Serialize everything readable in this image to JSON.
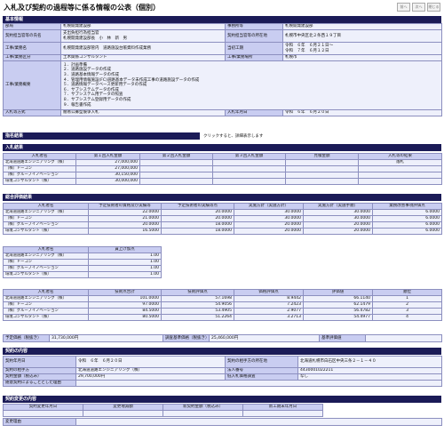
{
  "page": {
    "title": "入札及び契約の過程等に係る情報の公表（個別）",
    "nav_prev": "前へ",
    "nav_next": "次へ",
    "nav_close": "閉じる"
  },
  "basic": {
    "header": "基本情報",
    "rows": [
      {
        "l1": "部局",
        "v1": "札幌開発建設部",
        "l2": "事務所等",
        "v2": "札幌開発建設部"
      },
      {
        "l1": "契約担当官等の氏名",
        "v1": "支出負担行為担当官\n札幌開発建設部長　小　林　新　男",
        "l2": "契約担当官等の所在地",
        "v2": "札幌市中央区北２条西１９丁目"
      },
      {
        "l1": "工事/業務名",
        "v1": "札幌開発建設部管内　道路施設台帳資料作成業務",
        "l2": "当初工期",
        "v2": "令和　６年　６月２１日～\n令和　７年　６月１２日"
      },
      {
        "l1": "工事/業務区分",
        "v1": "土木関係コンサルタント",
        "l2": "工事/業務場所",
        "v2": "札幌市"
      }
    ],
    "summary_label": "工事/業務概要",
    "summary_lines": [
      "１．計画準備",
      "２．道路施設データの作成",
      "３．道路基本情報データの作成",
      "４．管理用情報施設(FC)道路基本データ未作成工事の道路施設データの作成",
      "５．道路情報データベース更新用データの作成",
      "６．サブシステムデータの作成",
      "７．サブシステム用データの照査",
      "８．サブシステム登録用データの作成",
      "９．報告書作成"
    ],
    "method_label": "入札等方式",
    "method_value": "簡易公募型競争入札",
    "date_label": "入札年月日",
    "date_value": "令和　６年　６月２０日"
  },
  "nominate": {
    "header": "指名結果",
    "note": "クリックすると、詳細表示します"
  },
  "bid": {
    "header": "入札結果",
    "cols": [
      "入札者名",
      "第１回入札金額",
      "第２回入札金額",
      "第３回入札金額",
      "見積金額",
      "入札等の結果"
    ],
    "rows": [
      {
        "name": "北海道道路エンジニアリング（株）",
        "a1": "27,000,000",
        "a2": "",
        "a3": "",
        "est": "",
        "res": "落札"
      },
      {
        "name": "（株）ドーコン",
        "a1": "27,000,000",
        "a2": "",
        "a3": "",
        "est": "",
        "res": ""
      },
      {
        "name": "（株）グループイノベーション",
        "a1": "30,150,000",
        "a2": "",
        "a3": "",
        "est": "",
        "res": ""
      },
      {
        "name": "環境コンサルタント（株）",
        "a1": "30,000,000",
        "a2": "",
        "a3": "",
        "est": "",
        "res": ""
      }
    ]
  },
  "eval": {
    "header": "総合評価結果",
    "t1_cols": [
      "入札者名",
      "予定技術者の資格及び実績等",
      "予定技術者の実績等点",
      "実施方針（実施方針）",
      "実施方針（実施手順）",
      "業務改善事項評価点"
    ],
    "t1_rows": [
      {
        "name": "北海道道路エンジニアリング（株）",
        "c1": "22.0000",
        "c2": "20.0000",
        "c3": "30.0000",
        "c4": "30.0000",
        "c5": "6.0000"
      },
      {
        "name": "（株）ドーコン",
        "c1": "21.0000",
        "c2": "20.0000",
        "c3": "30.0000",
        "c4": "30.0000",
        "c5": "6.0000"
      },
      {
        "name": "（株）グループイノベーション",
        "c1": "20.0000",
        "c2": "18.0000",
        "c3": "20.0000",
        "c4": "20.0000",
        "c5": "6.0000"
      },
      {
        "name": "環境コンサルタント（株）",
        "c1": "16.5000",
        "c2": "18.0000",
        "c3": "20.0000",
        "c4": "20.0000",
        "c5": "6.0000"
      }
    ],
    "t2_cols": [
      "入札者名",
      "賃上げ加点"
    ],
    "t2_rows": [
      {
        "name": "北海道道路エンジニアリング（株）",
        "c1": "1.00"
      },
      {
        "name": "（株）ドーコン",
        "c1": "1.00"
      },
      {
        "name": "（株）グループイノベーション",
        "c1": "1.00"
      },
      {
        "name": "環境コンサルタント（株）",
        "c1": "1.00"
      }
    ],
    "t3_cols": [
      "入札者名",
      "技術点合計",
      "技術評価点",
      "価格評価点",
      "評価値",
      "順位"
    ],
    "t3_rows": [
      {
        "name": "北海道道路エンジニアリング（株）",
        "c1": "101.0000",
        "c2": "57.1698",
        "c3": "8.9442",
        "c4": "66.1140",
        "c5": "1"
      },
      {
        "name": "（株）ドーコン",
        "c1": "97.0000",
        "c2": "54.9056",
        "c3": "7.2423",
        "c4": "62.1479",
        "c5": "2"
      },
      {
        "name": "（株）グループイノベーション",
        "c1": "84.5000",
        "c2": "53.4905",
        "c3": "2.9077",
        "c4": "56.4782",
        "c5": "3"
      },
      {
        "name": "環境コンサルタント（株）",
        "c1": "80.5000",
        "c2": "51.2264",
        "c3": "3.2713",
        "c4": "54.4977",
        "c5": "4"
      }
    ],
    "budget_label": "予定価格（税抜き）",
    "budget_value": "31,730,000円",
    "investigate_label": "調査基準価格（税抜き）",
    "investigate_value": "25,460,000円",
    "score_label": "基準評価値",
    "score_value": ""
  },
  "contract": {
    "header": "契約の内容",
    "rows": [
      {
        "l1": "契約年月日",
        "v1": "令和　６年　６月２０日",
        "l2": "契約の相手方の所在地",
        "v2": "北海道札幌市白石区中央三条２－１－４０"
      },
      {
        "l1": "契約の相手方",
        "v1": "北海道道路エンジニアリング（株）",
        "l2": "法人番号",
        "v2": "4430001022211"
      },
      {
        "l1": "契約金額（税込み）",
        "v1": "29,700,000円",
        "l2": "低入札価格調査",
        "v2": "なし"
      }
    ],
    "reason_label": "随意契約によることとした理由",
    "reason_value": ""
  },
  "change": {
    "header": "契約変更の内容",
    "cols": [
      "契約変更年月日",
      "変更増減額",
      "新契約金額（税込み）",
      "新工期末年月日"
    ],
    "reason_label": "変更理由"
  }
}
